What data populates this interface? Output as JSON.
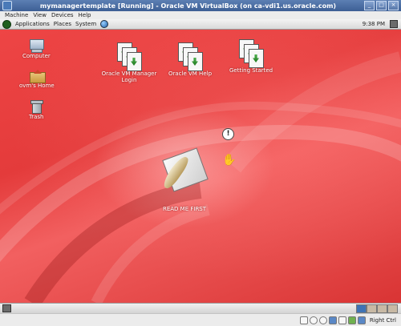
{
  "window": {
    "title": "mymanagertemplate [Running] - Oracle VM VirtualBox (on ca-vdi1.us.oracle.com)"
  },
  "vbox_menu": [
    "Machine",
    "View",
    "Devices",
    "Help"
  ],
  "guest_panel": {
    "menus": [
      "Applications",
      "Places",
      "System"
    ],
    "clock": "9:38 PM"
  },
  "desktop_icons": {
    "computer": "Computer",
    "home": "ovm's Home",
    "trash": "Trash",
    "manager_login": "Oracle VM Manager Login",
    "vm_help": "Oracle VM Help",
    "getting_started": "Getting Started",
    "readme": "READ ME FIRST"
  },
  "statusbar": {
    "host_key": "Right Ctrl"
  },
  "icons": {
    "window": "virtualbox-icon",
    "panel_foot": "gnome-foot-icon",
    "panel_web": "web-browser-icon",
    "alert": "exclamation-icon",
    "cursor": "hand-cursor-icon"
  }
}
